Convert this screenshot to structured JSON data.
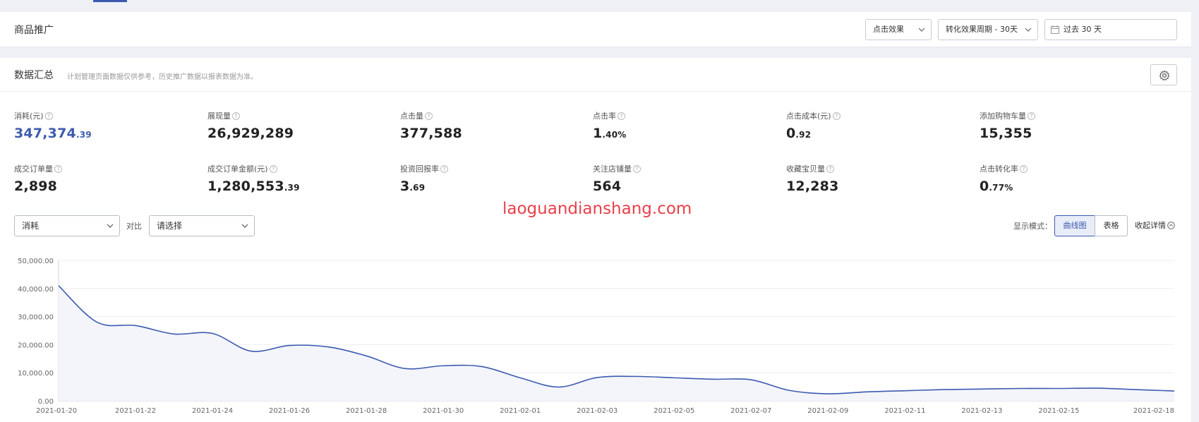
{
  "header": {
    "title": "商品推广",
    "effect_select": "点击效果",
    "period_select": "转化效果周期 - 30天",
    "date_range": "过去 30 天"
  },
  "summary": {
    "title": "数据汇总",
    "note": "计划管理页面数据仅供参考，历史推广数据以报表数据为准。",
    "settings_icon": "gear-icon"
  },
  "metrics": [
    {
      "label": "消耗(元)",
      "int": "347,374",
      "dec": ".39"
    },
    {
      "label": "展现量",
      "int": "26,929,289",
      "dec": ""
    },
    {
      "label": "点击量",
      "int": "377,588",
      "dec": ""
    },
    {
      "label": "点击率",
      "int": "1",
      "dec": ".40%"
    },
    {
      "label": "点击成本(元)",
      "int": "0",
      "dec": ".92"
    },
    {
      "label": "添加购物车量",
      "int": "15,355",
      "dec": ""
    },
    {
      "label": "成交订单量",
      "int": "2,898",
      "dec": ""
    },
    {
      "label": "成交订单金额(元)",
      "int": "1,280,553",
      "dec": ".39"
    },
    {
      "label": "投资回报率",
      "int": "3",
      "dec": ".69"
    },
    {
      "label": "关注店铺量",
      "int": "564",
      "dec": ""
    },
    {
      "label": "收藏宝贝量",
      "int": "12,283",
      "dec": ""
    },
    {
      "label": "点击转化率",
      "int": "0",
      "dec": ".77%"
    }
  ],
  "watermark": "laoguandianshang.com",
  "controls": {
    "metric_select": "消耗",
    "compare_label": "对比",
    "compare_select": "请选择",
    "mode_label": "显示模式：",
    "mode_line": "曲线图",
    "mode_table": "表格",
    "collapse": "收起详情"
  },
  "colors": {
    "accent": "#3d5ab0",
    "watermark": "#e8404a"
  },
  "chart_data": {
    "type": "area",
    "ylim": [
      0,
      50000
    ],
    "yticks": [
      "0.00",
      "10,000.00",
      "20,000.00",
      "30,000.00",
      "40,000.00",
      "50,000.00"
    ],
    "xticks": [
      "2021-01-20",
      "2021-01-22",
      "2021-01-24",
      "2021-01-26",
      "2021-01-28",
      "2021-01-30",
      "2021-02-01",
      "2021-02-03",
      "2021-02-05",
      "2021-02-07",
      "2021-02-09",
      "2021-02-11",
      "2021-02-13",
      "2021-02-15",
      "2021-02-18"
    ],
    "x": [
      "2021-01-20",
      "2021-01-21",
      "2021-01-22",
      "2021-01-23",
      "2021-01-24",
      "2021-01-25",
      "2021-01-26",
      "2021-01-27",
      "2021-01-28",
      "2021-01-29",
      "2021-01-30",
      "2021-01-31",
      "2021-02-01",
      "2021-02-02",
      "2021-02-03",
      "2021-02-04",
      "2021-02-05",
      "2021-02-06",
      "2021-02-07",
      "2021-02-08",
      "2021-02-09",
      "2021-02-10",
      "2021-02-11",
      "2021-02-12",
      "2021-02-13",
      "2021-02-14",
      "2021-02-15",
      "2021-02-16",
      "2021-02-17",
      "2021-02-18"
    ],
    "values": [
      41000,
      28000,
      26800,
      23800,
      24000,
      17700,
      19700,
      19200,
      16000,
      11500,
      12500,
      12200,
      8200,
      4900,
      8300,
      8700,
      8200,
      7700,
      7500,
      3700,
      2500,
      3200,
      3600,
      4000,
      4200,
      4400,
      4400,
      4500,
      4000,
      3500
    ],
    "grid": true
  }
}
